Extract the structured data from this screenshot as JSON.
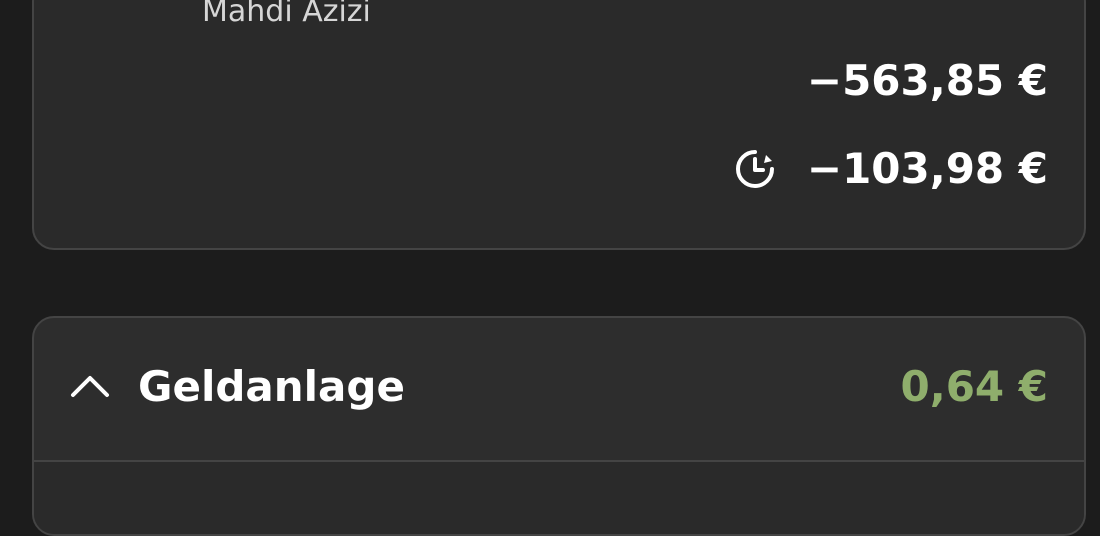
{
  "account": {
    "holder_name": "Mahdi Azizi",
    "balance": "−563,85 €",
    "pending_icon": "clock-rotate-icon",
    "pending_amount": "−103,98 €"
  },
  "section": {
    "icon": "chevron-up-icon",
    "title": "Geldanlage",
    "amount": "0,64 €",
    "amount_color": "#8fae6c"
  }
}
